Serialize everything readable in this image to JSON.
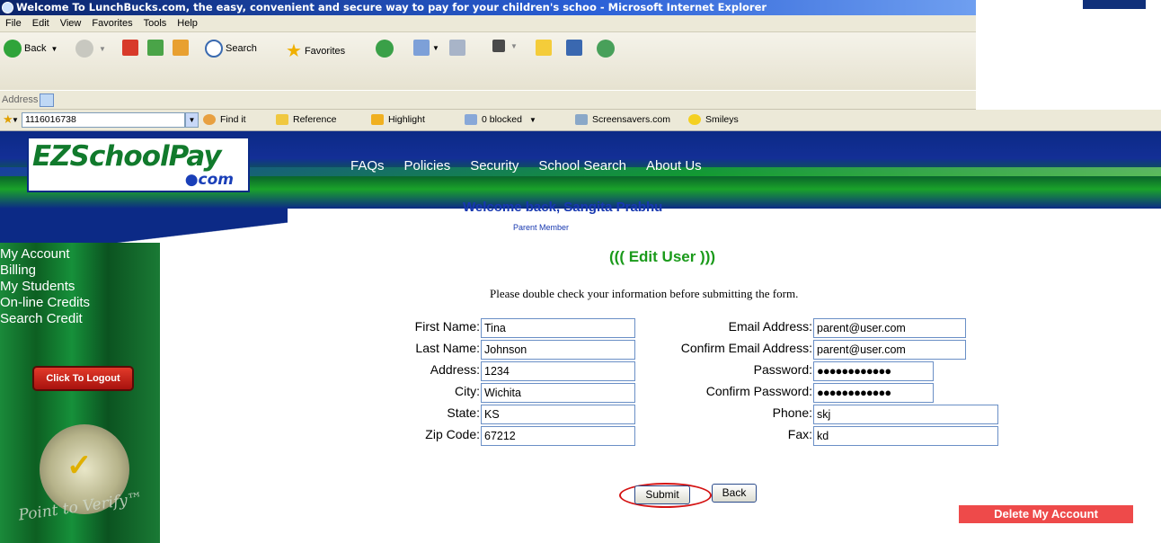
{
  "window": {
    "title": "Welcome To LunchBucks.com, the easy, convenient and secure way to pay for your children's schoo - Microsoft Internet Explorer"
  },
  "menu": [
    "File",
    "Edit",
    "View",
    "Favorites",
    "Tools",
    "Help"
  ],
  "toolbar": {
    "back_label": "Back",
    "search_label": "Search",
    "favorites_label": "Favorites"
  },
  "address": {
    "label": "Address"
  },
  "linksbar": {
    "search_value": "1116016738",
    "find_it": "Find it",
    "reference": "Reference",
    "highlight": "Highlight",
    "blocked": "0 blocked",
    "screensavers": "Screensavers.com",
    "smileys": "Smileys"
  },
  "site": {
    "logo_main": "EZSchoolPay",
    "logo_sub": "●com",
    "nav": [
      "FAQs",
      "Policies",
      "Security",
      "School Search",
      "About Us"
    ]
  },
  "sidebar": {
    "items": [
      "My Account",
      "Billing",
      "My Students",
      "On-line Credits",
      "Search Credit"
    ],
    "logout": "Click To Logout",
    "point_to_verify": "Point to Verify™"
  },
  "main": {
    "welcome": "Welcome back, Sangita Prabhu",
    "member_type": "Parent Member",
    "form_title": "(((  Edit User  )))",
    "instructions": "Please double check your information before submitting the form."
  },
  "form": {
    "first_name": {
      "label": "First Name:",
      "value": "Tina"
    },
    "last_name": {
      "label": "Last Name:",
      "value": "Johnson"
    },
    "address": {
      "label": "Address:",
      "value": "1234"
    },
    "city": {
      "label": "City:",
      "value": "Wichita"
    },
    "state": {
      "label": "State:",
      "value": "KS"
    },
    "zip": {
      "label": "Zip Code:",
      "value": "67212"
    },
    "email": {
      "label": "Email Address:",
      "value": "parent@user.com"
    },
    "confirm_email": {
      "label": "Confirm Email Address:",
      "value": "parent@user.com"
    },
    "password": {
      "label": "Password:",
      "value": "●●●●●●●●●●●●"
    },
    "confirm_password": {
      "label": "Confirm Password:",
      "value": "●●●●●●●●●●●●"
    },
    "phone": {
      "label": "Phone:",
      "value": "skj"
    },
    "fax": {
      "label": "Fax:",
      "value": "kd"
    }
  },
  "buttons": {
    "submit": "Submit",
    "back": "Back",
    "delete_account": "Delete My Account"
  },
  "colors": {
    "brand_blue": "#0c2a86",
    "brand_green": "#117a2c",
    "welcome_text": "#1738b0",
    "edit_title": "#1a9a1a",
    "delete_button": "#ee4a4a",
    "highlight_ring": "#d41414"
  }
}
